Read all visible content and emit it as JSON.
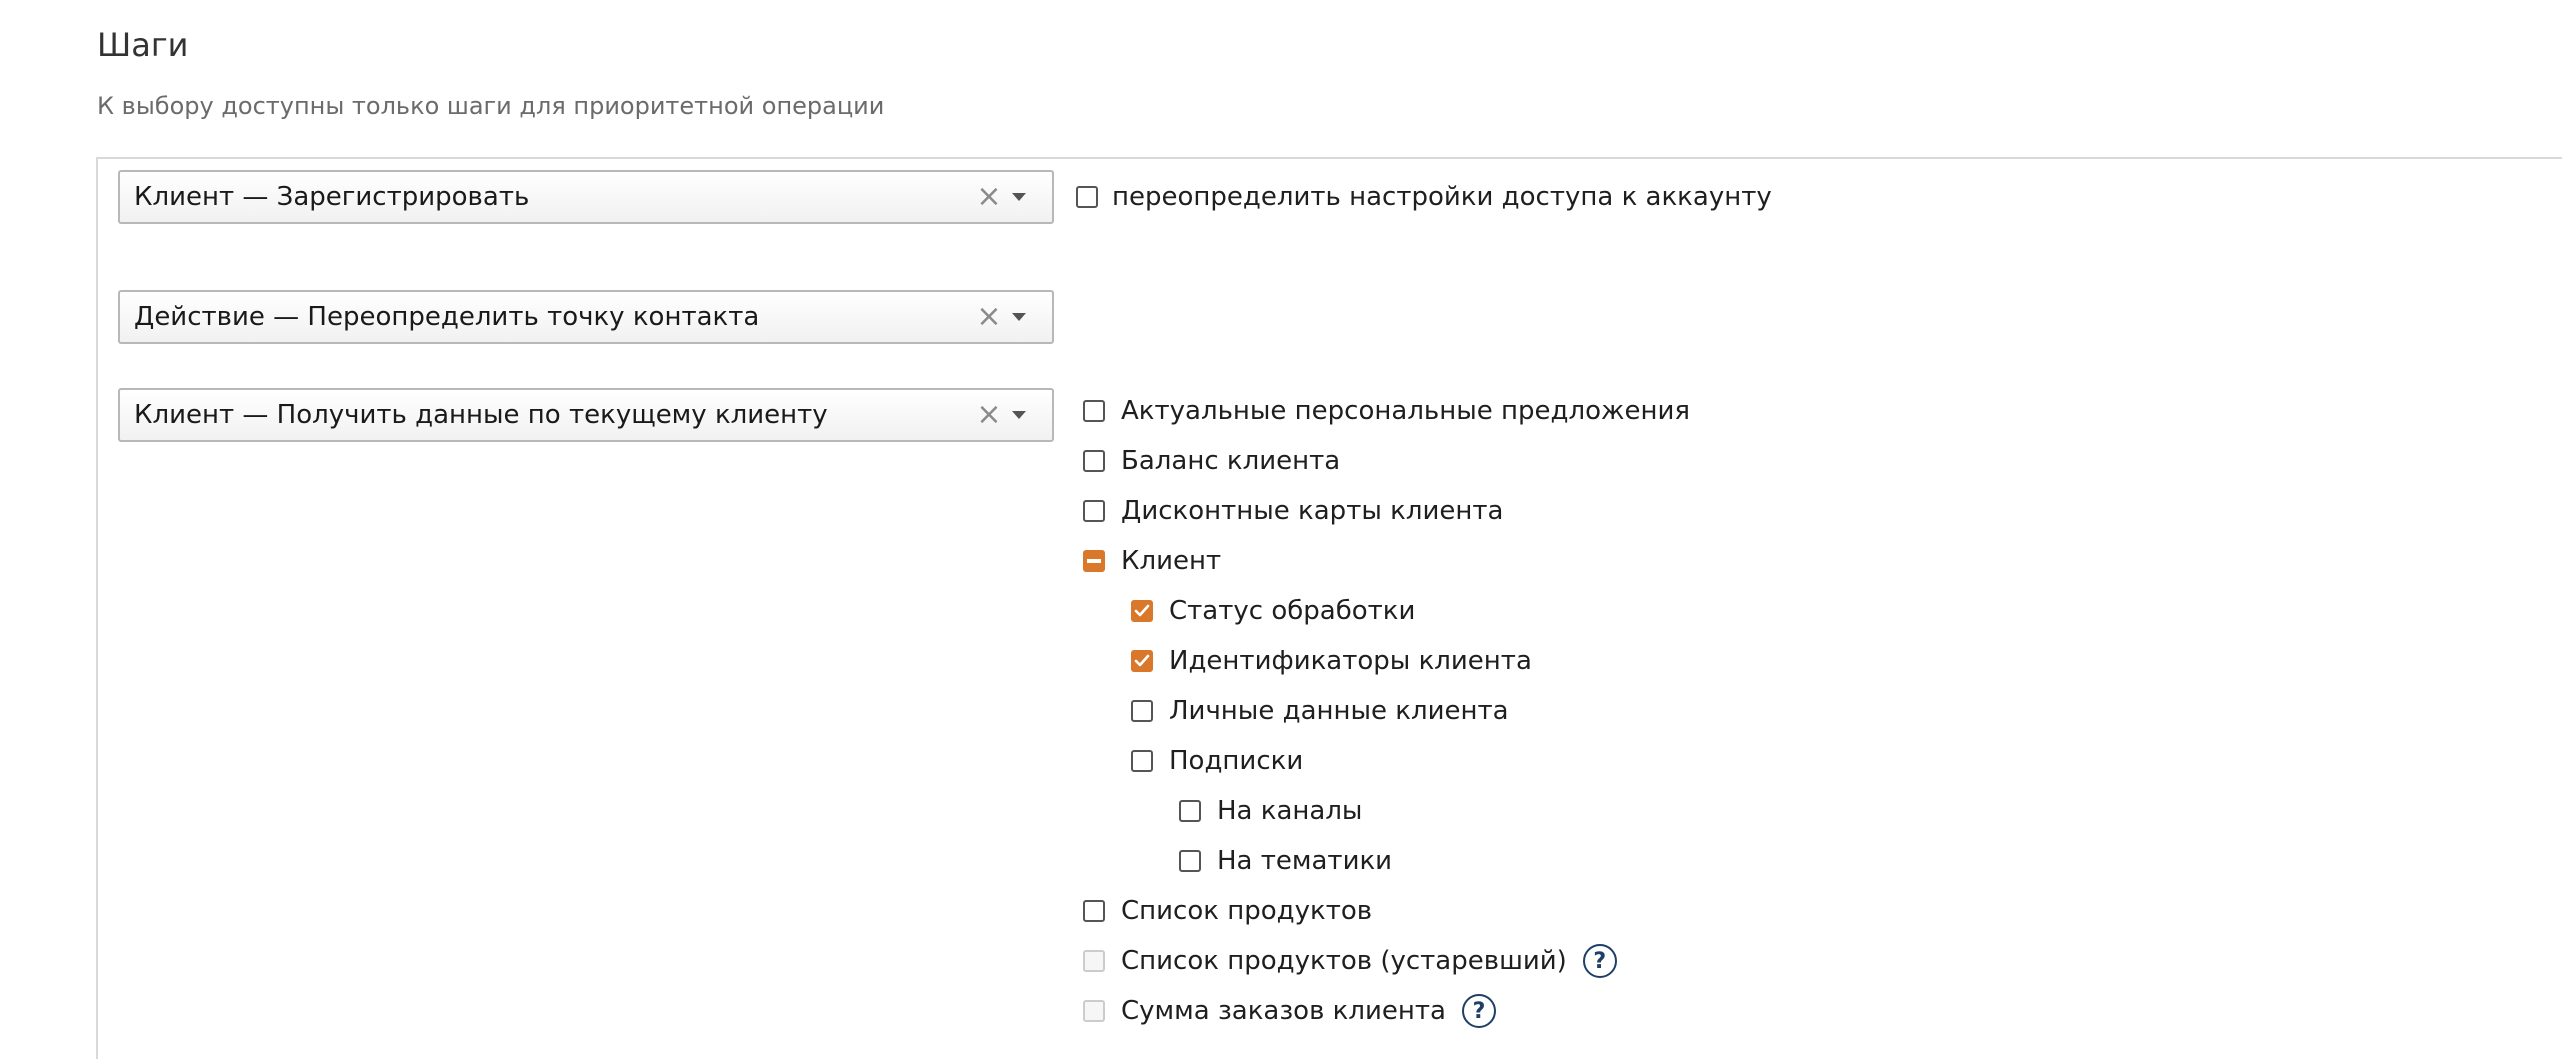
{
  "section": {
    "title": "Шаги",
    "subtitle": "К выбору доступны только шаги для приоритетной операции"
  },
  "steps": [
    {
      "label": "Клиент — Зарегистрировать"
    },
    {
      "label": "Действие — Переопределить точку контакта"
    },
    {
      "label": "Клиент — Получить данные по текущему клиенту"
    }
  ],
  "override_access": {
    "label": "переопределить настройки доступа к аккаунту",
    "checked": false
  },
  "options": [
    {
      "label": "Актуальные персональные предложения",
      "state": "unchecked",
      "level": 0
    },
    {
      "label": "Баланс клиента",
      "state": "unchecked",
      "level": 0
    },
    {
      "label": "Дисконтные карты клиента",
      "state": "unchecked",
      "level": 0
    },
    {
      "label": "Клиент",
      "state": "partial",
      "level": 0
    },
    {
      "label": "Статус обработки",
      "state": "checked",
      "level": 1
    },
    {
      "label": "Идентификаторы клиента",
      "state": "checked",
      "level": 1
    },
    {
      "label": "Личные данные клиента",
      "state": "unchecked",
      "level": 1
    },
    {
      "label": "Подписки",
      "state": "unchecked",
      "level": 1
    },
    {
      "label": "На каналы",
      "state": "unchecked",
      "level": 2
    },
    {
      "label": "На тематики",
      "state": "unchecked",
      "level": 2
    },
    {
      "label": "Список продуктов",
      "state": "unchecked",
      "level": 0
    },
    {
      "label": "Список продуктов (устаревший)",
      "state": "disabled",
      "level": 0,
      "help": "?"
    },
    {
      "label": "Сумма заказов клиента",
      "state": "disabled",
      "level": 0,
      "help": "?"
    }
  ],
  "colors": {
    "accent": "#d9782b",
    "help": "#1e3f66"
  }
}
